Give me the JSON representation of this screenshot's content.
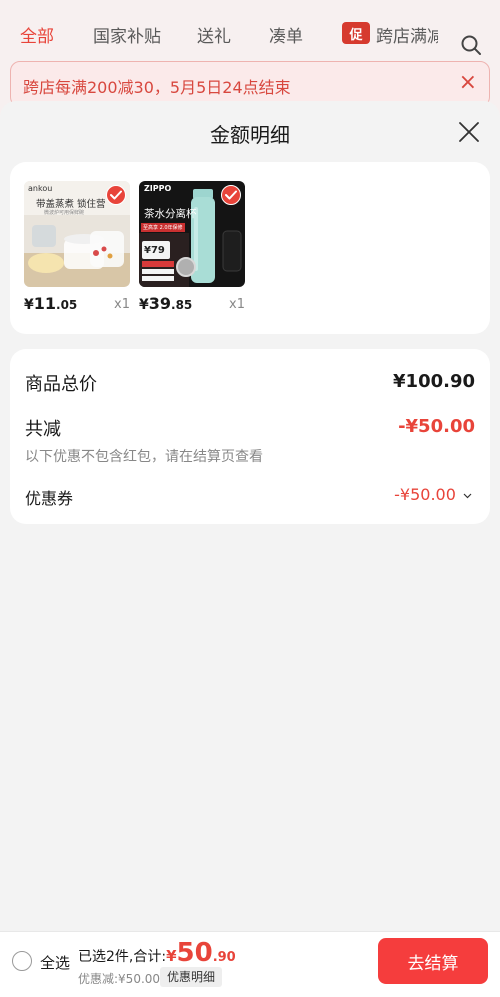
{
  "tabs": [
    {
      "label": "全部",
      "active": true
    },
    {
      "label": "国家补贴",
      "active": false
    },
    {
      "label": "送礼",
      "active": false
    },
    {
      "label": "凑单",
      "active": false
    },
    {
      "label": "跨店满减",
      "active": false,
      "badge": "促"
    }
  ],
  "banner": {
    "text": "跨店每满200减30，5月5日24点结束"
  },
  "sheet": {
    "title": "金额明细",
    "products": [
      {
        "brand": "ankou",
        "caption": "带盖蒸煮 锁住营",
        "sub_caption": "微波炉可用保鲜碗",
        "price_yen": "¥",
        "price_int": "11",
        "price_dec": ".05",
        "qty": "x1",
        "selected": true
      },
      {
        "brand": "ZIPPO",
        "caption": "茶水分离杯",
        "promo_line": "至高享 2.0年保修",
        "price_badge": "¥79",
        "price_yen": "¥",
        "price_int": "39",
        "price_dec": ".85",
        "qty": "x1",
        "selected": true
      }
    ],
    "summary": {
      "total_label": "商品总价",
      "total_value": "¥100.90",
      "reduce_label": "共减",
      "reduce_value": "-¥50.00",
      "note": "以下优惠不包含红包，请在结算页查看",
      "coupon_label": "优惠券",
      "coupon_value": "-¥50.00"
    }
  },
  "bottom_bar": {
    "select_all_label": "全选",
    "selected_text": "已选2件,合计:",
    "total_yen": "¥",
    "total_int": "50",
    "total_dec": ".90",
    "discount_text": "优惠减:¥50.00",
    "detail_link": "优惠明细",
    "checkout_label": "去结算"
  },
  "colors": {
    "accent": "#e8443a",
    "checkout": "#f53d3d"
  }
}
